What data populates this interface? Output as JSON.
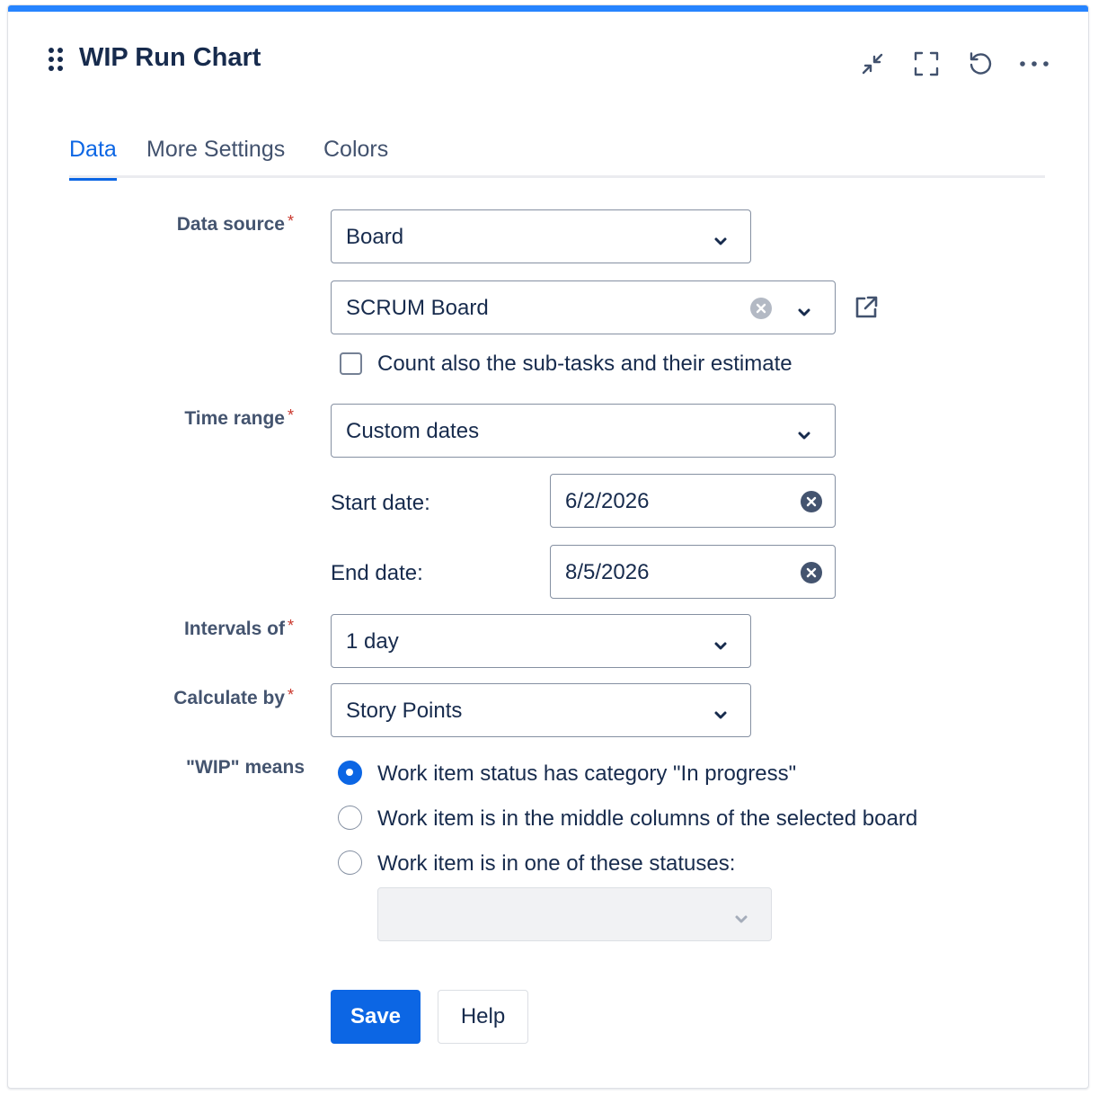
{
  "header": {
    "title": "WIP Run Chart",
    "icons": [
      "drag-handle-icon",
      "minimize-icon",
      "fullscreen-icon",
      "refresh-icon",
      "more-icon"
    ]
  },
  "tabs": [
    {
      "label": "Data",
      "active": true
    },
    {
      "label": "More Settings",
      "active": false
    },
    {
      "label": "Colors",
      "active": false
    }
  ],
  "form": {
    "data_source": {
      "label": "Data source",
      "type_value": "Board",
      "board_value": "SCRUM Board",
      "subtasks_label": "Count also the sub-tasks and their estimate",
      "subtasks_checked": false
    },
    "time_range": {
      "label": "Time range",
      "value": "Custom dates",
      "start_label": "Start date:",
      "start_value": "6/2/2026",
      "end_label": "End date:",
      "end_value": "8/5/2026"
    },
    "intervals": {
      "label": "Intervals of",
      "value": "1 day"
    },
    "calculate_by": {
      "label": "Calculate by",
      "value": "Story Points"
    },
    "wip_means": {
      "label": "\"WIP\" means",
      "options": [
        {
          "label": "Work item status has category \"In progress\"",
          "checked": true
        },
        {
          "label": "Work item is in the middle columns of the selected board",
          "checked": false
        },
        {
          "label": "Work item is in one of these statuses:",
          "checked": false
        }
      ],
      "statuses_value": ""
    },
    "required_mark": "*"
  },
  "actions": {
    "save_label": "Save",
    "help_label": "Help"
  },
  "colors": {
    "accent": "#0c66e4",
    "top_bar": "#2684ff",
    "required": "#c9372c",
    "text": "#172b4d",
    "label": "#44546f"
  }
}
